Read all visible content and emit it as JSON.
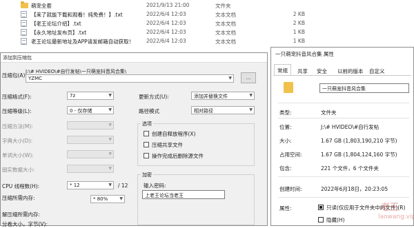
{
  "explorer": {
    "files": [
      {
        "icon": "folder-icon",
        "name": "萌宠全套",
        "date": "2021/9/13 21:00",
        "type": "文件夹",
        "size": ""
      },
      {
        "icon": "txt-file-icon",
        "name": "【来了就能下载和观看！纯免费！】.txt",
        "date": "2022/6/4 12:03",
        "type": "文本文档",
        "size": "2 KB"
      },
      {
        "icon": "txt-file-icon",
        "name": "【老王论坛介绍】.txt",
        "date": "2022/6/4 12:03",
        "type": "文本文档",
        "size": "2 KB"
      },
      {
        "icon": "txt-file-icon",
        "name": "【永久地址发布页】.txt",
        "date": "2022/6/4 12:03",
        "type": "文本文档",
        "size": "1 KB"
      },
      {
        "icon": "txt-file-icon",
        "name": "老王论坛最新地址及APP请发邮箱自动获取！",
        "date": "2022/6/4 12:03",
        "type": "文本文档",
        "size": "1 KB"
      }
    ]
  },
  "archive": {
    "title": "添加到压缩包",
    "archive_name_label": "压缩包(A):",
    "archive_path": "J:\\# HVIDEO\\#自行发帖\\一只萌宠抖音风合集\\",
    "archive_name_value": "YZMC",
    "browse_label": "...",
    "format_label": "压缩格式(F):",
    "format_value": "7z",
    "level_label": "压缩等级(L):",
    "level_value": "0 - 仅存储",
    "method_label": "压缩方法(M):",
    "dict_label": "字典大小(D):",
    "word_label": "单词大小(W):",
    "solid_label": "固实数据大小:",
    "threads_label": "CPU 线程数(H):",
    "threads_value": "* 12",
    "threads_total": "/ 12",
    "mem_label": "压缩所需内存:",
    "mem_value": "* 80%",
    "decomp_mem_label": "解压缩所需内存:",
    "volume_label": "分卷大小，字节(V):",
    "update_label": "更新方式(U):",
    "update_value": "添加并替换文件",
    "path_mode_label": "路径模式",
    "path_mode_value": "相对路径",
    "options_title": "选项",
    "opt_sfx": "创建自释放程序(X)",
    "opt_shared": "压缩共享文件",
    "opt_delete": "操作完成后删除源文件",
    "encrypt_title": "加密",
    "password_label": "输入密码:",
    "password_value": "上老王论坛当老王"
  },
  "props": {
    "title": "一只萌宠抖音风合集 属性",
    "tabs": [
      "常规",
      "共享",
      "安全",
      "以前的版本",
      "自定义"
    ],
    "active_tab": "常规",
    "folder_name": "一只萌宠抖音风合集",
    "type_label": "类型:",
    "type_value": "文件夹",
    "location_label": "位置:",
    "location_value": "J:\\# HVIDEO\\#自行发帖",
    "size_label": "大小:",
    "size_value": "1.67 GB (1,803,190,210 字节)",
    "disk_label": "占用空间:",
    "disk_value": "1.67 GB (1,804,124,160 字节)",
    "contains_label": "包含:",
    "contains_value": "221 个文件，6 个文件夹",
    "created_label": "创建时间:",
    "created_value": "2022年6月18日，20:23:05",
    "attr_label": "属性:",
    "attr_readonly": "只读(仅应用于文件夹中的文件)(R)",
    "attr_hidden": "隐藏(H)"
  },
  "watermark": {
    "line1": "老王",
    "line2": "laowang.vip"
  }
}
